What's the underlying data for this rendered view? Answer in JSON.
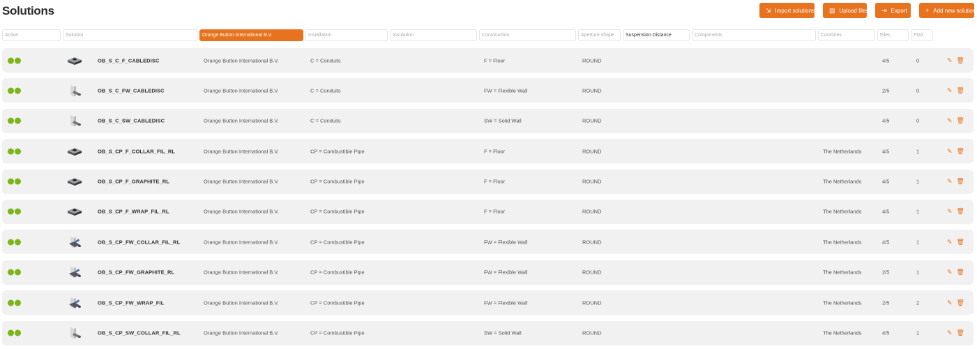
{
  "page": {
    "title": "Solutions"
  },
  "toolbar": {
    "import_label": "Import solutions",
    "upload_label": "Upload files",
    "export_label": "Export",
    "add_label": "Add new solution"
  },
  "filters": {
    "active": "Active",
    "solution": "Solution",
    "organisation": "Orange Button International B.V.",
    "installation": "Installation",
    "insulation": "Insulation",
    "construction": "Construction",
    "aperture": "Aperture shape",
    "suspension": "Suspension Distance",
    "components": "Components",
    "countries": "Countries",
    "files": "Files",
    "fda": "FDA"
  },
  "colors": {
    "accent": "#e8731f",
    "active_dot": "#7cb518",
    "row_bg": "#f1f1f1"
  },
  "rows": [
    {
      "thumb": "floor",
      "name": "OB_S_C_F_CABLEDISC",
      "org": "Orange Button International B.V.",
      "installation": "C = Conduits",
      "construction": "F = Floor",
      "aperture": "ROUND",
      "country": "",
      "files": "4/5",
      "fda": "0"
    },
    {
      "thumb": "wall",
      "name": "OB_S_C_FW_CABLEDISC",
      "org": "Orange Button International B.V.",
      "installation": "C = Conduits",
      "construction": "FW = Flexible Wall",
      "aperture": "ROUND",
      "country": "",
      "files": "2/5",
      "fda": "0"
    },
    {
      "thumb": "wall",
      "name": "OB_S_C_SW_CABLEDISC",
      "org": "Orange Button International B.V.",
      "installation": "C = Conduits",
      "construction": "SW = Solid Wall",
      "aperture": "ROUND",
      "country": "",
      "files": "4/5",
      "fda": "0"
    },
    {
      "thumb": "floor",
      "name": "OB_S_CP_F_COLLAR_FIL_RL",
      "org": "Orange Button International B.V.",
      "installation": "CP = Combustible Pipe",
      "construction": "F = Floor",
      "aperture": "ROUND",
      "country": "The Netherlands",
      "files": "4/5",
      "fda": "1"
    },
    {
      "thumb": "floor",
      "name": "OB_S_CP_F_GRAPHITE_RL",
      "org": "Orange Button International B.V.",
      "installation": "CP = Combustible Pipe",
      "construction": "F = Floor",
      "aperture": "ROUND",
      "country": "The Netherlands",
      "files": "4/5",
      "fda": "1"
    },
    {
      "thumb": "floor",
      "name": "OB_S_CP_F_WRAP_FIL_RL",
      "org": "Orange Button International B.V.",
      "installation": "CP = Combustible Pipe",
      "construction": "F = Floor",
      "aperture": "ROUND",
      "country": "The Netherlands",
      "files": "4/5",
      "fda": "1"
    },
    {
      "thumb": "wall-blue",
      "name": "OB_S_CP_FW_COLLAR_FIL_RL",
      "org": "Orange Button International B.V.",
      "installation": "CP = Combustible Pipe",
      "construction": "FW = Flexible Wall",
      "aperture": "ROUND",
      "country": "The Netherlands",
      "files": "4/5",
      "fda": "1"
    },
    {
      "thumb": "wall-blue",
      "name": "OB_S_CP_FW_GRAPHITE_RL",
      "org": "Orange Button International B.V.",
      "installation": "CP = Combustible Pipe",
      "construction": "FW = Flexible Wall",
      "aperture": "ROUND",
      "country": "The Netherlands",
      "files": "2/5",
      "fda": "1"
    },
    {
      "thumb": "wall-blue",
      "name": "OB_S_CP_FW_WRAP_FIL",
      "org": "Orange Button International B.V.",
      "installation": "CP = Combustible Pipe",
      "construction": "FW = Flexible Wall",
      "aperture": "ROUND",
      "country": "The Netherlands",
      "files": "2/5",
      "fda": "2"
    },
    {
      "thumb": "wall",
      "name": "OB_S_CP_SW_COLLAR_FIL_RL",
      "org": "Orange Button International B.V.",
      "installation": "CP = Combustible Pipe",
      "construction": "SW = Solid Wall",
      "aperture": "ROUND",
      "country": "The Netherlands",
      "files": "4/5",
      "fda": "1"
    }
  ]
}
